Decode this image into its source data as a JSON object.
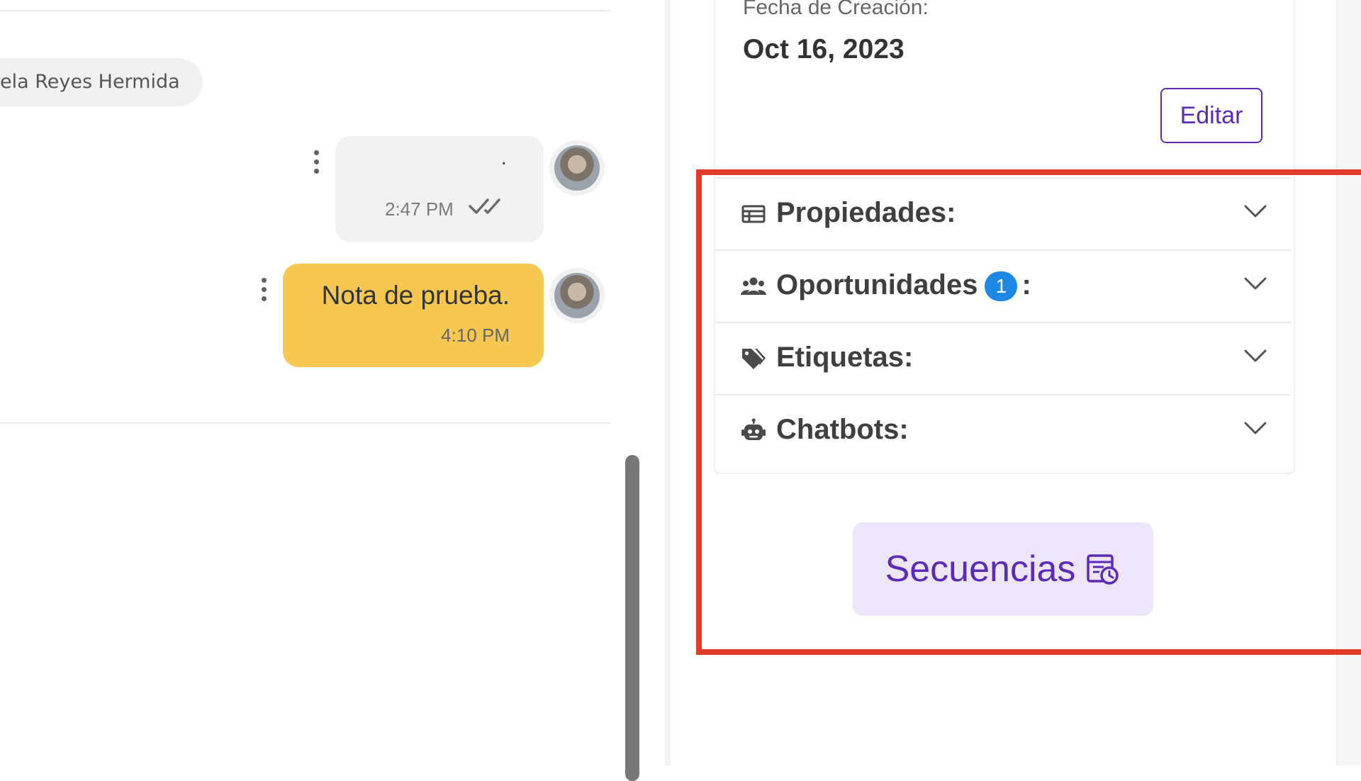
{
  "chat": {
    "system_message": "ela Reyes Hermida",
    "messages": [
      {
        "text": ".",
        "time": "2:47 PM"
      },
      {
        "text": "Nota de prueba.",
        "time": "4:10 PM"
      }
    ]
  },
  "contact_panel": {
    "creation_label": "Fecha de Creación:",
    "creation_date": "Oct 16, 2023",
    "edit_label": "Editar",
    "sections": [
      {
        "title": "Propiedades:",
        "icon": "table-icon"
      },
      {
        "title": "Oportunidades",
        "badge": "1",
        "suffix": ":",
        "icon": "users-icon"
      },
      {
        "title": "Etiquetas:",
        "icon": "tags-icon"
      },
      {
        "title": "Chatbots:",
        "icon": "robot-icon"
      }
    ],
    "sequences_label": "Secuencias"
  },
  "colors": {
    "accent": "#5b2bb8",
    "note_bubble": "#f6c751",
    "badge": "#1e88e5",
    "highlight": "#e23b2b"
  }
}
